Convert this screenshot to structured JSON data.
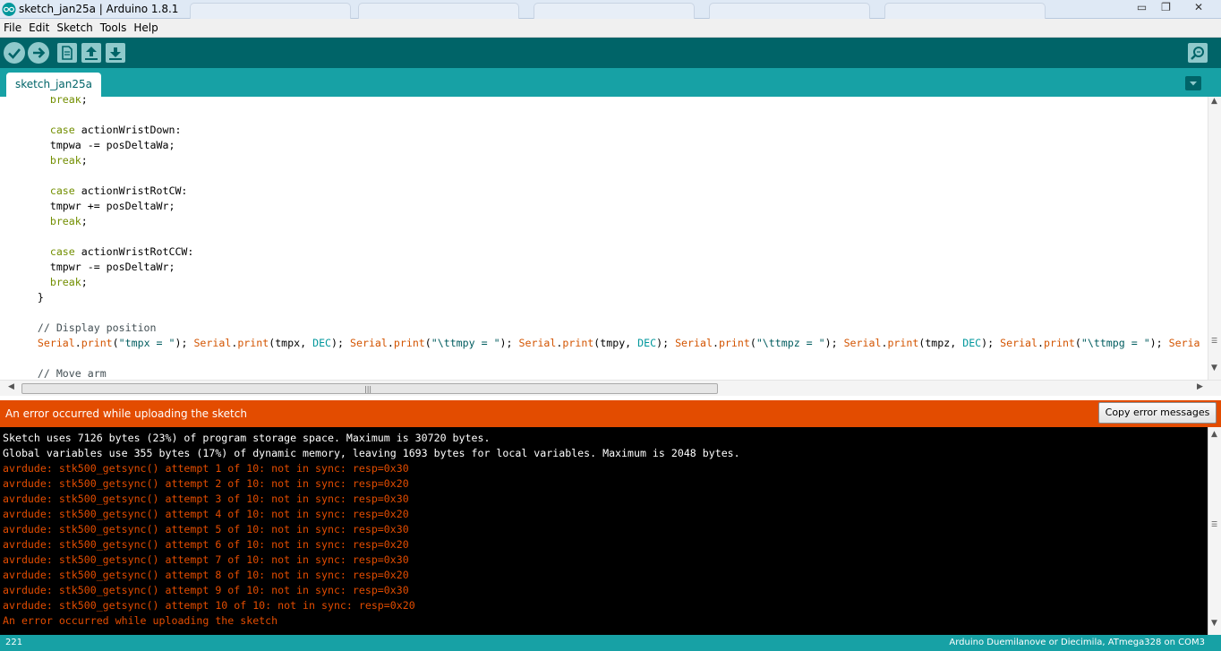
{
  "window": {
    "title": "sketch_jan25a | Arduino 1.8.1",
    "controls": {
      "minimize": "▭",
      "maximize": "❐",
      "close": "✕"
    }
  },
  "menu": {
    "items": [
      "File",
      "Edit",
      "Sketch",
      "Tools",
      "Help"
    ]
  },
  "toolbar": {
    "icons": [
      "verify-icon",
      "upload-icon",
      "new-icon",
      "open-icon",
      "save-icon",
      "serial-monitor-icon"
    ]
  },
  "tabs": {
    "active": "sketch_jan25a"
  },
  "editor": {
    "lines": [
      {
        "indent": "        ",
        "parts": [
          [
            "kw",
            "break"
          ],
          [
            "",
            ";"
          ]
        ]
      },
      {
        "indent": "",
        "parts": []
      },
      {
        "indent": "        ",
        "parts": [
          [
            "kw",
            "case"
          ],
          [
            "",
            " actionWristDown:"
          ]
        ]
      },
      {
        "indent": "        ",
        "parts": [
          [
            "",
            "tmpwa -= posDeltaWa;"
          ]
        ]
      },
      {
        "indent": "        ",
        "parts": [
          [
            "kw",
            "break"
          ],
          [
            "",
            ";"
          ]
        ]
      },
      {
        "indent": "",
        "parts": []
      },
      {
        "indent": "        ",
        "parts": [
          [
            "kw",
            "case"
          ],
          [
            "",
            " actionWristRotCW:"
          ]
        ]
      },
      {
        "indent": "        ",
        "parts": [
          [
            "",
            "tmpwr += posDeltaWr;"
          ]
        ]
      },
      {
        "indent": "        ",
        "parts": [
          [
            "kw",
            "break"
          ],
          [
            "",
            ";"
          ]
        ]
      },
      {
        "indent": "",
        "parts": []
      },
      {
        "indent": "        ",
        "parts": [
          [
            "kw",
            "case"
          ],
          [
            "",
            " actionWristRotCCW:"
          ]
        ]
      },
      {
        "indent": "        ",
        "parts": [
          [
            "",
            "tmpwr -= posDeltaWr;"
          ]
        ]
      },
      {
        "indent": "        ",
        "parts": [
          [
            "kw",
            "break"
          ],
          [
            "",
            ";"
          ]
        ]
      },
      {
        "indent": "      ",
        "parts": [
          [
            "",
            "}"
          ]
        ]
      },
      {
        "indent": "",
        "parts": []
      },
      {
        "indent": "      ",
        "parts": [
          [
            "cmt",
            "// Display position"
          ]
        ]
      },
      {
        "indent": "      ",
        "parts": [
          [
            "fn",
            "Serial"
          ],
          [
            "",
            "."
          ],
          [
            "fn",
            "print"
          ],
          [
            "",
            "("
          ],
          [
            "str",
            "\"tmpx = \""
          ],
          [
            "",
            "); "
          ],
          [
            "fn",
            "Serial"
          ],
          [
            "",
            "."
          ],
          [
            "fn",
            "print"
          ],
          [
            "",
            "(tmpx, "
          ],
          [
            "cst",
            "DEC"
          ],
          [
            "",
            "); "
          ],
          [
            "fn",
            "Serial"
          ],
          [
            "",
            "."
          ],
          [
            "fn",
            "print"
          ],
          [
            "",
            "("
          ],
          [
            "str",
            "\"\\ttmpy = \""
          ],
          [
            "",
            "); "
          ],
          [
            "fn",
            "Serial"
          ],
          [
            "",
            "."
          ],
          [
            "fn",
            "print"
          ],
          [
            "",
            "(tmpy, "
          ],
          [
            "cst",
            "DEC"
          ],
          [
            "",
            "); "
          ],
          [
            "fn",
            "Serial"
          ],
          [
            "",
            "."
          ],
          [
            "fn",
            "print"
          ],
          [
            "",
            "("
          ],
          [
            "str",
            "\"\\ttmpz = \""
          ],
          [
            "",
            "); "
          ],
          [
            "fn",
            "Serial"
          ],
          [
            "",
            "."
          ],
          [
            "fn",
            "print"
          ],
          [
            "",
            "(tmpz, "
          ],
          [
            "cst",
            "DEC"
          ],
          [
            "",
            "); "
          ],
          [
            "fn",
            "Serial"
          ],
          [
            "",
            "."
          ],
          [
            "fn",
            "print"
          ],
          [
            "",
            "("
          ],
          [
            "str",
            "\"\\ttmpg = \""
          ],
          [
            "",
            "); "
          ],
          [
            "fn",
            "Seria"
          ]
        ]
      },
      {
        "indent": "",
        "parts": []
      },
      {
        "indent": "      ",
        "parts": [
          [
            "cmt",
            "// Move arm"
          ]
        ]
      }
    ]
  },
  "status": {
    "message": "An error occurred while uploading the sketch",
    "copy_button": "Copy error messages",
    "color": "#e34c00"
  },
  "console": {
    "lines": [
      {
        "type": "white",
        "text": "Sketch uses 7126 bytes (23%) of program storage space. Maximum is 30720 bytes."
      },
      {
        "type": "white",
        "text": "Global variables use 355 bytes (17%) of dynamic memory, leaving 1693 bytes for local variables. Maximum is 2048 bytes."
      },
      {
        "type": "err",
        "text": "avrdude: stk500_getsync() attempt 1 of 10: not in sync: resp=0x30"
      },
      {
        "type": "err",
        "text": "avrdude: stk500_getsync() attempt 2 of 10: not in sync: resp=0x20"
      },
      {
        "type": "err",
        "text": "avrdude: stk500_getsync() attempt 3 of 10: not in sync: resp=0x30"
      },
      {
        "type": "err",
        "text": "avrdude: stk500_getsync() attempt 4 of 10: not in sync: resp=0x20"
      },
      {
        "type": "err",
        "text": "avrdude: stk500_getsync() attempt 5 of 10: not in sync: resp=0x30"
      },
      {
        "type": "err",
        "text": "avrdude: stk500_getsync() attempt 6 of 10: not in sync: resp=0x20"
      },
      {
        "type": "err",
        "text": "avrdude: stk500_getsync() attempt 7 of 10: not in sync: resp=0x30"
      },
      {
        "type": "err",
        "text": "avrdude: stk500_getsync() attempt 8 of 10: not in sync: resp=0x20"
      },
      {
        "type": "err",
        "text": "avrdude: stk500_getsync() attempt 9 of 10: not in sync: resp=0x30"
      },
      {
        "type": "err",
        "text": "avrdude: stk500_getsync() attempt 10 of 10: not in sync: resp=0x20"
      },
      {
        "type": "err",
        "text": "An error occurred while uploading the sketch"
      }
    ]
  },
  "footer": {
    "line_number": "221",
    "board": "Arduino Duemilanove or Diecimila, ATmega328 on COM3"
  },
  "colors": {
    "toolbar": "#006468",
    "tabstrip": "#17a1a5",
    "error": "#e34c00"
  }
}
